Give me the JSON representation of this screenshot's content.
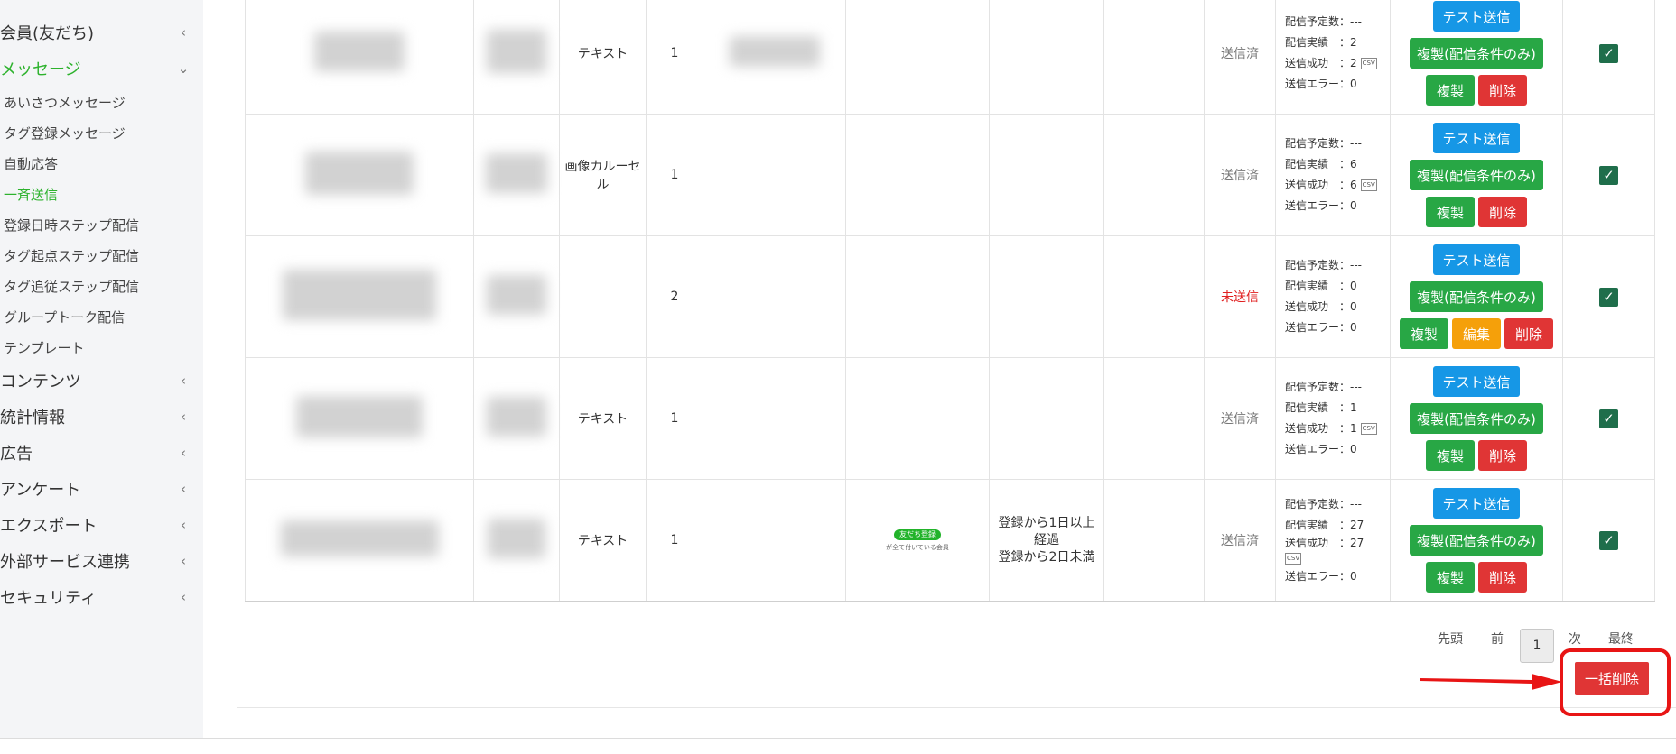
{
  "sidebar": {
    "items": [
      {
        "label": "会員(友だち)",
        "chevron": "‹"
      },
      {
        "label": "メッセージ",
        "chevron": "⌄"
      },
      {
        "label": "コンテンツ",
        "chevron": "‹"
      },
      {
        "label": "統計情報",
        "chevron": "‹"
      },
      {
        "label": "広告",
        "chevron": "‹"
      },
      {
        "label": "アンケート",
        "chevron": "‹"
      },
      {
        "label": "エクスポート",
        "chevron": "‹"
      },
      {
        "label": "外部サービス連携",
        "chevron": "‹"
      },
      {
        "label": "セキュリティ",
        "chevron": "‹"
      }
    ],
    "message_submenu": [
      "あいさつメッセージ",
      "タグ登録メッセージ",
      "自動応答",
      "一斉送信",
      "登録日時ステップ配信",
      "タグ起点ステップ配信",
      "タグ追従ステップ配信",
      "グループトーク配信",
      "テンプレート"
    ]
  },
  "labels": {
    "planned": "配信予定数：",
    "planned_value": "---",
    "actual": "配信実績　：",
    "success": "送信成功　：",
    "error": "送信エラー：",
    "csv": "CSV",
    "btn_test": "テスト送信",
    "btn_copy_cond": "複製(配信条件のみ)",
    "btn_copy": "複製",
    "btn_edit": "編集",
    "btn_delete": "削除"
  },
  "rows": [
    {
      "type": "テキスト",
      "count": "1",
      "status": "送信済",
      "actual": "2",
      "success": "2",
      "error": "0"
    },
    {
      "type": "画像カルーセル",
      "count": "1",
      "status": "送信済",
      "actual": "6",
      "success": "6",
      "error": "0"
    },
    {
      "type": "",
      "count": "2",
      "status": "未送信",
      "actual": "0",
      "success": "0",
      "error": "0"
    },
    {
      "type": "テキスト",
      "count": "1",
      "status": "送信済",
      "actual": "1",
      "success": "1",
      "error": "0"
    },
    {
      "type": "テキスト",
      "count": "1",
      "status": "送信済",
      "actual": "27",
      "success": "27",
      "error": "0",
      "badge": "友だち登録",
      "badge_sub": "が全て付いている会員",
      "condition_1": "登録から1日以上",
      "condition_2": "経過",
      "condition_3": "登録から2日未満"
    }
  ],
  "pagination": {
    "first": "先頭",
    "prev": "前",
    "current": "1",
    "next": "次",
    "last": "最終"
  },
  "bulk_delete": "一括削除",
  "colors": {
    "accent_green": "#2db22d",
    "button_blue": "#1697e6",
    "button_green": "#28a745",
    "button_red": "#e03535",
    "button_orange": "#f5a00a",
    "highlight_red": "#e81515"
  }
}
